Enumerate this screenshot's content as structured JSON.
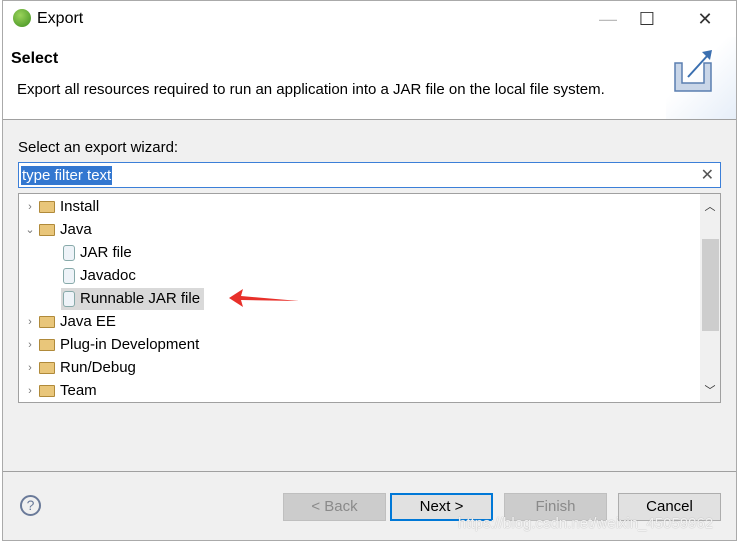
{
  "window": {
    "title": "Export"
  },
  "header": {
    "title": "Select",
    "description": "Export all resources required to run an application into a JAR file on the local file system."
  },
  "wizard_label": "Select an export wizard:",
  "filter": {
    "value": "type filter text"
  },
  "tree": [
    {
      "label": "Install",
      "level": 0,
      "expanded": false,
      "icon": "folder-icon"
    },
    {
      "label": "Java",
      "level": 0,
      "expanded": true,
      "icon": "folder-icon"
    },
    {
      "label": "JAR file",
      "level": 1,
      "icon": "jar-icon"
    },
    {
      "label": "Javadoc",
      "level": 1,
      "icon": "javadoc-icon"
    },
    {
      "label": "Runnable JAR file",
      "level": 1,
      "icon": "runnable-jar-icon",
      "selected": true
    },
    {
      "label": "Java EE",
      "level": 0,
      "expanded": false,
      "icon": "folder-icon"
    },
    {
      "label": "Plug-in Development",
      "level": 0,
      "expanded": false,
      "icon": "folder-icon"
    },
    {
      "label": "Run/Debug",
      "level": 0,
      "expanded": false,
      "icon": "folder-icon"
    },
    {
      "label": "Team",
      "level": 0,
      "expanded": false,
      "icon": "folder-icon"
    }
  ],
  "buttons": {
    "back": "< Back",
    "next": "Next >",
    "finish": "Finish",
    "cancel": "Cancel"
  },
  "watermark": "https://blog.csdn.net/weixin_45059962",
  "colors": {
    "accent": "#0078d7",
    "selection": "#3377d0",
    "annotation_arrow": "#e8302a"
  }
}
